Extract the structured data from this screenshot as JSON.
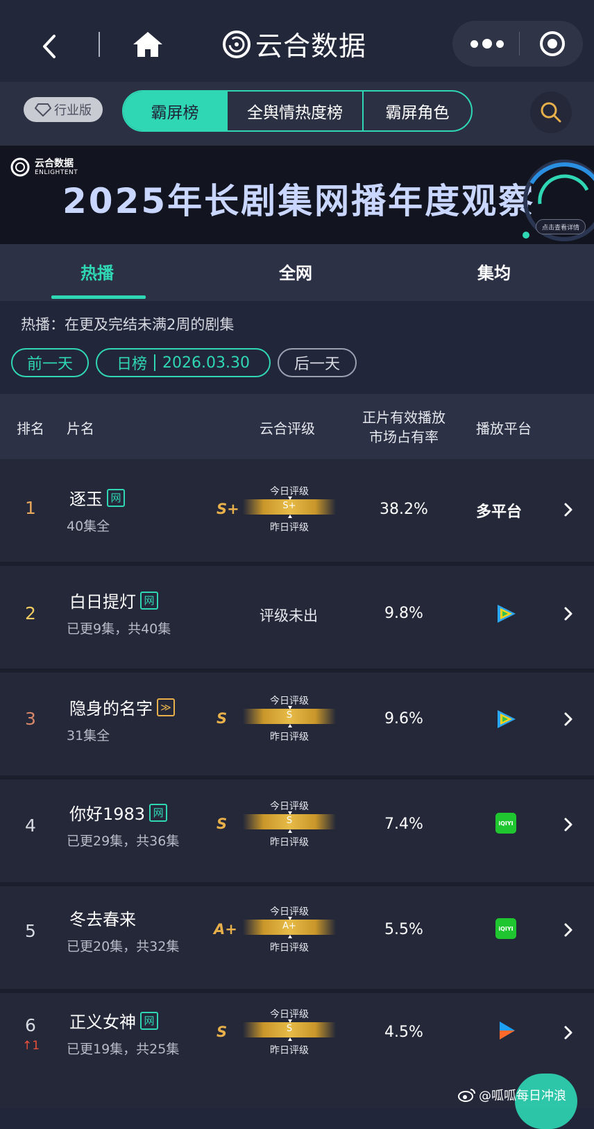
{
  "nav": {
    "app_name": "云合数据"
  },
  "edition_badge": "行业版",
  "segments": [
    {
      "label": "霸屏榜",
      "active": true
    },
    {
      "label": "全舆情热度榜",
      "active": false
    },
    {
      "label": "霸屏角色",
      "active": false
    }
  ],
  "banner": {
    "logo_cn": "云合数据",
    "logo_en": "ENLIGHTENT",
    "title": "2025年长剧集网播年度观察",
    "detail_button": "点击查看详情"
  },
  "tabs": [
    {
      "label": "热播",
      "active": true
    },
    {
      "label": "全网",
      "active": false
    },
    {
      "label": "集均",
      "active": false
    }
  ],
  "description": "热播：在更及完结未满2周的剧集",
  "date_controls": {
    "prev": "前一天",
    "kind": "日榜",
    "date": "2026.03.30",
    "next": "后一天"
  },
  "table_headers": {
    "rank": "排名",
    "title": "片名",
    "rating": "云合评级",
    "share_line1": "正片有效播放",
    "share_line2": "市场占有率",
    "platform": "播放平台"
  },
  "meter_labels": {
    "today": "今日评级",
    "yesterday": "昨日评级"
  },
  "rows": [
    {
      "rank": "1",
      "title": "逐玉",
      "tag": "网",
      "episodes": "40集全",
      "grade": "S+",
      "today_grade": "S+",
      "share": "38.2%",
      "platform": "多平台",
      "platform_icon": "text"
    },
    {
      "rank": "2",
      "title": "白日提灯",
      "tag": "网",
      "episodes": "已更9集，共40集",
      "grade": "",
      "no_grade_text": "评级未出",
      "share": "9.8%",
      "platform_icon": "tencent-video-icon"
    },
    {
      "rank": "3",
      "title": "隐身的名字",
      "tag": "≫",
      "episodes": "31集全",
      "grade": "S",
      "today_grade": "S",
      "share": "9.6%",
      "platform_icon": "tencent-video-icon"
    },
    {
      "rank": "4",
      "title": "你好1983",
      "tag": "网",
      "episodes": "已更29集，共36集",
      "grade": "S",
      "today_grade": "S",
      "share": "7.4%",
      "platform_icon": "iqiyi-icon",
      "platform_icon_text": "iQIYI"
    },
    {
      "rank": "5",
      "title": "冬去春来",
      "tag": "",
      "episodes": "已更20集，共32集",
      "grade": "A+",
      "today_grade": "A+",
      "share": "5.5%",
      "platform_icon": "iqiyi-icon",
      "platform_icon_text": "iQIYI"
    },
    {
      "rank": "6",
      "rank_change": "1",
      "title": "正义女神",
      "tag": "网",
      "episodes": "已更19集，共25集",
      "grade": "S",
      "today_grade": "S",
      "share": "4.5%",
      "platform_icon": "youku-icon"
    }
  ],
  "watermark": "@呱呱每日冲浪"
}
